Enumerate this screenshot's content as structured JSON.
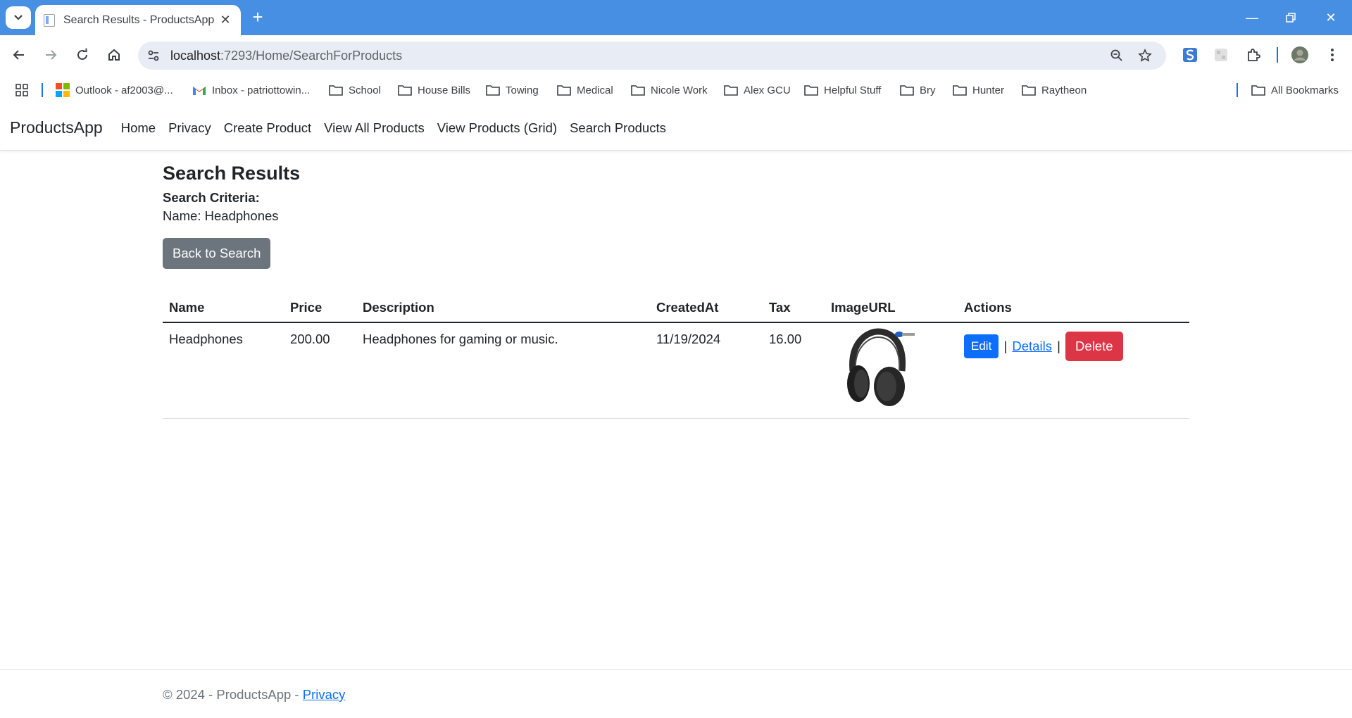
{
  "browser": {
    "tab_title": "Search Results - ProductsApp",
    "url_host": "localhost",
    "url_path": ":7293/Home/SearchForProducts",
    "bookmarks": [
      {
        "label": "Outlook - af2003@...",
        "icon": "outlook-icon"
      },
      {
        "label": "Inbox - patriottowin...",
        "icon": "gmail-icon"
      },
      {
        "label": "School",
        "icon": "folder-icon"
      },
      {
        "label": "House Bills",
        "icon": "folder-icon"
      },
      {
        "label": "Towing",
        "icon": "folder-icon"
      },
      {
        "label": "Medical",
        "icon": "folder-icon"
      },
      {
        "label": "Nicole Work",
        "icon": "folder-icon"
      },
      {
        "label": "Alex GCU",
        "icon": "folder-icon"
      },
      {
        "label": "Helpful Stuff",
        "icon": "folder-icon"
      },
      {
        "label": "Bry",
        "icon": "folder-icon"
      },
      {
        "label": "Hunter",
        "icon": "folder-icon"
      },
      {
        "label": "Raytheon",
        "icon": "folder-icon"
      }
    ],
    "all_bookmarks": "All Bookmarks",
    "accent_color": "#478fe3"
  },
  "app": {
    "brand": "ProductsApp",
    "nav": [
      "Home",
      "Privacy",
      "Create Product",
      "View All Products",
      "View Products (Grid)",
      "Search Products"
    ]
  },
  "search": {
    "title": "Search Results",
    "criteria_label": "Search Criteria:",
    "criteria_value": "Name: Headphones",
    "back_button": "Back to Search"
  },
  "table": {
    "headers": [
      "Name",
      "Price",
      "Description",
      "CreatedAt",
      "Tax",
      "ImageURL",
      "Actions"
    ],
    "rows": [
      {
        "name": "Headphones",
        "price": "200.00",
        "description": "Headphones for gaming or music.",
        "created_at": "11/19/2024",
        "tax": "16.00",
        "image_icon": "headphones-image",
        "actions": {
          "edit": "Edit",
          "separator": "|",
          "details": "Details",
          "delete": "Delete"
        }
      }
    ]
  },
  "footer": {
    "text": "© 2024 - ProductsApp - ",
    "privacy_link": "Privacy"
  },
  "colors": {
    "primary": "#0d6efd",
    "danger": "#dc3545",
    "secondary": "#6c757d"
  }
}
